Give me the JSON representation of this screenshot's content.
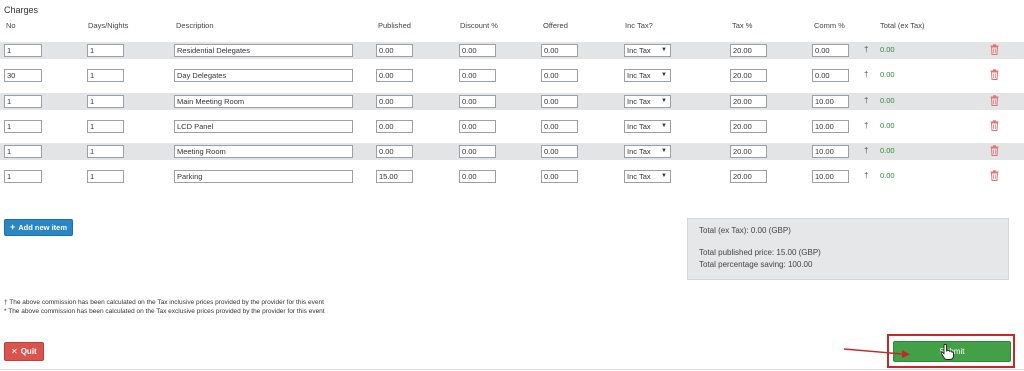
{
  "section_title": "Charges",
  "headers": [
    "No",
    "Days/Nights",
    "Description",
    "Published",
    "Discount %",
    "Offered",
    "Inc Tax?",
    "Tax %",
    "Comm %",
    "Total (ex Tax)"
  ],
  "rows": [
    {
      "no": "1",
      "days": "1",
      "description": "Residential Delegates",
      "published": "0.00",
      "discount": "0.00",
      "offered": "0.00",
      "inc_tax": "Inc Tax",
      "tax": "20.00",
      "comm": "0.00",
      "dagger": "†",
      "total": "0.00"
    },
    {
      "no": "30",
      "days": "1",
      "description": "Day Delegates",
      "published": "0.00",
      "discount": "0.00",
      "offered": "0.00",
      "inc_tax": "Inc Tax",
      "tax": "20.00",
      "comm": "0.00",
      "dagger": "†",
      "total": "0.00"
    },
    {
      "no": "1",
      "days": "1",
      "description": "Main Meeting Room",
      "published": "0.00",
      "discount": "0.00",
      "offered": "0.00",
      "inc_tax": "Inc Tax",
      "tax": "20.00",
      "comm": "10.00",
      "dagger": "†",
      "total": "0.00"
    },
    {
      "no": "1",
      "days": "1",
      "description": "LCD Panel",
      "published": "0.00",
      "discount": "0.00",
      "offered": "0.00",
      "inc_tax": "Inc Tax",
      "tax": "20.00",
      "comm": "10.00",
      "dagger": "†",
      "total": "0.00"
    },
    {
      "no": "1",
      "days": "1",
      "description": "Meeting Room",
      "published": "0.00",
      "discount": "0.00",
      "offered": "0.00",
      "inc_tax": "Inc Tax",
      "tax": "20.00",
      "comm": "10.00",
      "dagger": "†",
      "total": "0.00"
    },
    {
      "no": "1",
      "days": "1",
      "description": "Parking",
      "published": "15.00",
      "discount": "0.00",
      "offered": "0.00",
      "inc_tax": "Inc Tax",
      "tax": "20.00",
      "comm": "10.00",
      "dagger": "†",
      "total": "0.00"
    }
  ],
  "add_item_label": "Add new item",
  "summary": {
    "total_ex_tax": "Total (ex Tax): 0.00 (GBP)",
    "total_published": "Total published price: 15.00 (GBP)",
    "total_saving": "Total percentage saving: 100.00"
  },
  "notes": [
    "† The above commission has been calculated on the Tax inclusive prices provided by the provider for this event",
    "* The above commission has been calculated on the Tax exclusive prices provided by the provider for this event"
  ],
  "quit_label": "Quit",
  "submit_label": "Submit",
  "colors": {
    "add_button": "#2a86c4",
    "quit_button": "#d9534f",
    "submit_button": "#43a047",
    "total_text": "#2e8b3a",
    "highlight_frame": "#c62828"
  },
  "icons": {
    "add": "plus-icon",
    "quit": "close-icon",
    "delete": "trash-icon",
    "cursor": "hand-pointer-icon"
  }
}
